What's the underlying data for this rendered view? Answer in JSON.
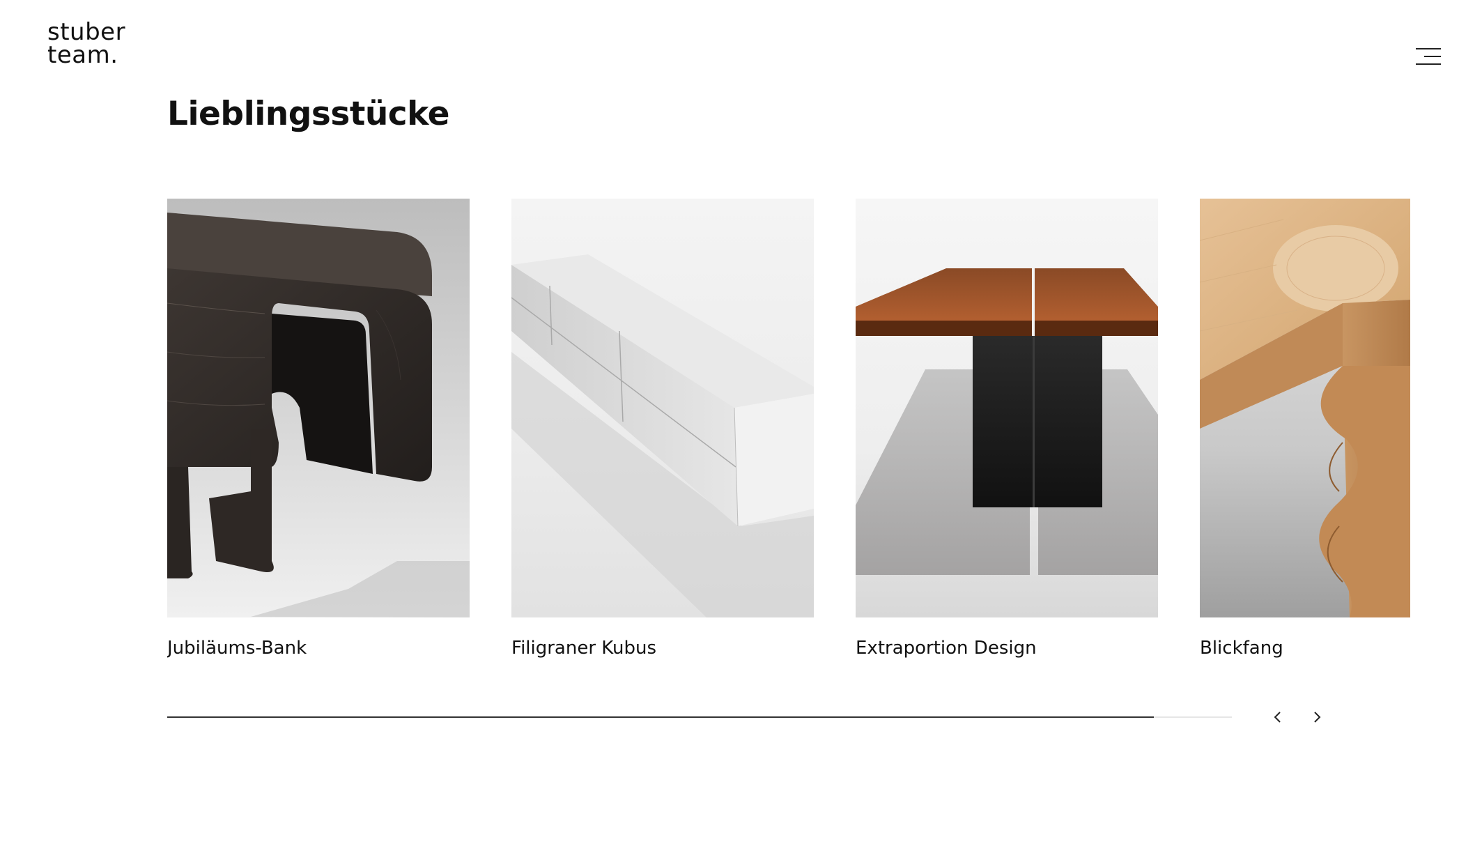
{
  "logo": {
    "line1": "stuber",
    "line2": "team."
  },
  "page_title": "Lieblingsstücke",
  "products": [
    {
      "label": "Jubiläums-Bank"
    },
    {
      "label": "Filigraner Kubus"
    },
    {
      "label": "Extraportion Design"
    },
    {
      "label": "Blickfang"
    }
  ],
  "carousel": {
    "progress": 0.927
  },
  "icons": {
    "menu": "hamburger-menu-icon",
    "prev": "chevron-left-icon",
    "next": "chevron-right-icon"
  },
  "colors": {
    "text": "#111111",
    "progress_fill": "#333333",
    "progress_track": "#e6e6e6"
  }
}
